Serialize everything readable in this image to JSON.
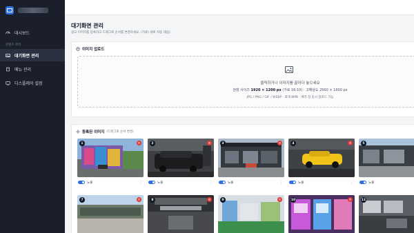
{
  "sidebar": {
    "items": [
      {
        "label": "대시보드",
        "icon": "dashboard-icon"
      },
      {
        "label": "대기화면 관리",
        "icon": "image-icon",
        "active": true
      },
      {
        "label": "메뉴 관리",
        "icon": "book-icon"
      },
      {
        "label": "디스플레이 설정",
        "icon": "settings-icon"
      }
    ],
    "section_label": "콘텐츠 관리"
  },
  "page": {
    "title": "대기화면 관리",
    "description": "광고 이미지를 등록하고 드래그로 순서를 변경하세요. (가로) 세로 자동 대응)"
  },
  "upload": {
    "title": "이미지 업로드",
    "prompt": "클릭하거나 이미지를 끌어다 놓으세요",
    "size_prefix": "권장 사이즈",
    "size_value": "1920 × 1200 px",
    "size_ratio": "(가로 16:10)",
    "size_suffix": "· 고해상도 2560 × 1600 px",
    "formats": "JPG / PNG / GIF / WEBP · 최대 8MB · 여러 장 동시 업로드 가능"
  },
  "gallery": {
    "title": "등록된 이미지",
    "subtitle": "(드래그로 순서 변경)",
    "toggle_label": "노출",
    "delete_symbol": "×",
    "menu_symbol": "⋮",
    "items": [
      {
        "index": "1",
        "show_controls": true
      },
      {
        "index": "2",
        "show_controls": true
      },
      {
        "index": "3",
        "show_controls": true
      },
      {
        "index": "4",
        "show_controls": true
      },
      {
        "index": "5",
        "show_controls": true
      },
      {
        "index": "7",
        "show_controls": false
      },
      {
        "index": "8",
        "show_controls": false
      },
      {
        "index": "9",
        "show_controls": false
      },
      {
        "index": "10",
        "show_controls": false
      },
      {
        "index": "11",
        "show_controls": false
      }
    ]
  },
  "colors": {
    "sidebar_bg": "#1a1f2b",
    "accent": "#2f6fe4",
    "delete_red": "#e53935"
  }
}
